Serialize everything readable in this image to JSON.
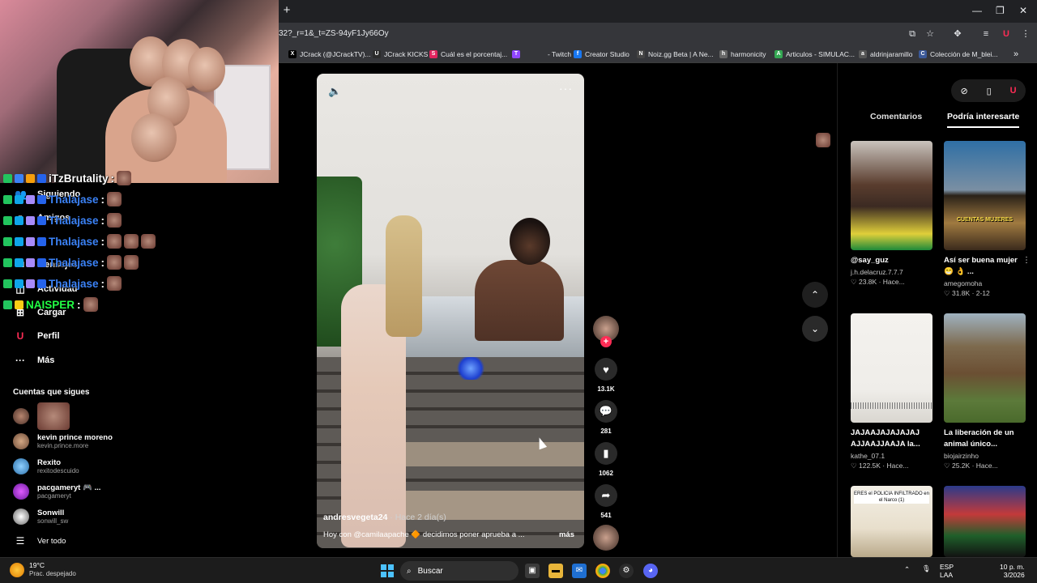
{
  "browser": {
    "url": "32?_r=1&_t=ZS-94yF1Jy66Oy",
    "new_tab": "+",
    "bookmarks": [
      {
        "label": "JCrack (@JCrackTV)...",
        "color": "#000000",
        "glyph": "X"
      },
      {
        "label": "JCrack KICKS",
        "color": "#2b2b2b",
        "glyph": "U"
      },
      {
        "label": "Cuál es el porcentaj...",
        "color": "#e0245e",
        "glyph": "S"
      },
      {
        "label": "- Twitch",
        "color": "#9146ff",
        "glyph": "T"
      },
      {
        "label": "Creator Studio",
        "color": "#1877f2",
        "glyph": "f"
      },
      {
        "label": "Noiz.gg Beta | A Ne...",
        "color": "#444444",
        "glyph": "N"
      },
      {
        "label": "harmonicity",
        "color": "#666666",
        "glyph": "h"
      },
      {
        "label": "Articulos - SIMULAC...",
        "color": "#34a853",
        "glyph": "A"
      },
      {
        "label": "aldrinjaramillo",
        "color": "#555555",
        "glyph": "a"
      },
      {
        "label": "Colección de M_blei...",
        "color": "#3b5998",
        "glyph": "C"
      }
    ],
    "more_bookmarks": "»"
  },
  "chat": [
    {
      "user": "iTzBrutality",
      "color": "#ffffff"
    },
    {
      "user": "Thalajase",
      "color": "#3b82f6"
    },
    {
      "user": "Thalajase",
      "color": "#3b82f6"
    },
    {
      "user": "Thalajase",
      "color": "#3b82f6"
    },
    {
      "user": "Thalajase",
      "color": "#3b82f6"
    },
    {
      "user": "Thalajase",
      "color": "#3b82f6"
    },
    {
      "user": "NAISPER",
      "color": "#22ff44"
    }
  ],
  "chat_separator": ":",
  "sidebar": {
    "items": [
      {
        "label": "Siguiendo",
        "icon": "following-icon"
      },
      {
        "label": "Amigos",
        "icon": "friends-icon"
      },
      {
        "label": "Mensajes",
        "icon": "messages-icon"
      },
      {
        "label": "Actividad",
        "icon": "activity-icon"
      },
      {
        "label": "Cargar",
        "icon": "upload-icon"
      },
      {
        "label": "Perfil",
        "icon": "profile-icon"
      },
      {
        "label": "Más",
        "icon": "more-icon"
      }
    ],
    "follow_title": "Cuentas que sigues",
    "accounts": [
      {
        "name": "kevin prince moreno",
        "handle": "kevin.prince.more"
      },
      {
        "name": "Rexito",
        "handle": "rexitodescuido"
      },
      {
        "name": "pacgameryt 🎮 ...",
        "handle": "pacgameryt"
      },
      {
        "name": "Sonwill",
        "handle": "sonwill_sw"
      }
    ],
    "see_all": "Ver todo"
  },
  "video": {
    "author": "andresvegeta24",
    "ago": " · Hace 2 día(s)",
    "caption": "Hoy con @camilaapache 🔶 decidimos poner aprueba a ...",
    "more": "más"
  },
  "actions": {
    "likes": "13.1K",
    "comments": "281",
    "saves": "1062",
    "shares": "541"
  },
  "panel": {
    "tab_comments": "Comentarios",
    "tab_suggested": "Podría interesarte",
    "cards": [
      {
        "title": "@say_guz",
        "user": "j.h.delacruz.7.7.7",
        "views": "23.8K",
        "time": "Hace..."
      },
      {
        "title": "Así ser buena mujer😁 👌 ...",
        "user": "amegomoha",
        "views": "31.8K",
        "time": "2-12"
      },
      {
        "title": "JAJAAJAJAJAJAJ AJJAAJJAAJA la...",
        "user": "kathe_07.1",
        "views": "122.5K",
        "time": "Hace..."
      },
      {
        "title": "La liberación de un animal único...",
        "user": "biojairzinho",
        "views": "25.2K",
        "time": "Hace..."
      }
    ],
    "thumb_text_1": "CUENTAS MUJERES",
    "thumb_text_2": "ERES el POLICIA INFILTRADO en el Narco (1)"
  },
  "taskbar": {
    "temp": "19°C",
    "weather": "Prac. despejado",
    "search": "Buscar",
    "lang": "ESP",
    "layout": "LAA",
    "time": "10 p. m.",
    "date": "3/2026"
  }
}
